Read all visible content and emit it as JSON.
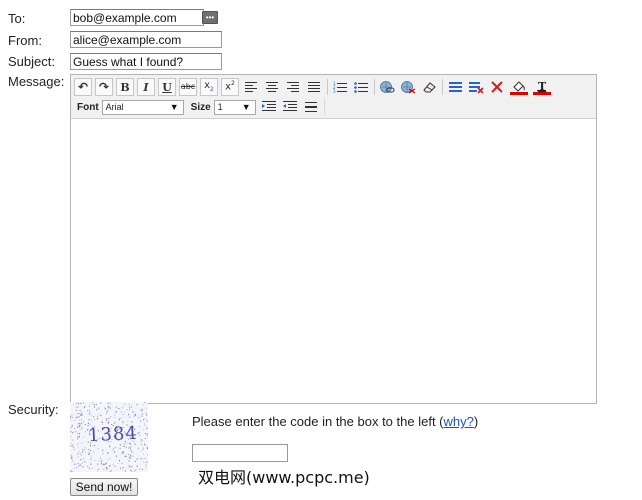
{
  "form": {
    "to_label": "To:",
    "to_value": "bob@example.com",
    "from_label": "From:",
    "from_value": "alice@example.com",
    "subject_label": "Subject:",
    "subject_value": "Guess what I found?",
    "message_label": "Message:",
    "security_label": "Security:"
  },
  "toolbar": {
    "row1": [
      {
        "name": "undo-button",
        "glyph": "↶",
        "title": "undo"
      },
      {
        "name": "redo-button",
        "glyph": "↷",
        "title": "redo"
      },
      {
        "name": "bold-button",
        "glyph": "B",
        "title": "bold"
      },
      {
        "name": "italic-button",
        "glyph": "I",
        "title": "italic"
      },
      {
        "name": "underline-button",
        "glyph": "U",
        "title": "underline"
      },
      {
        "name": "strikethrough-button",
        "glyph": "abc",
        "title": "strikethrough"
      },
      {
        "name": "subscript-button",
        "glyph": "x₂",
        "title": "subscript"
      },
      {
        "name": "superscript-button",
        "glyph": "x²",
        "title": "superscript"
      }
    ],
    "font_label": "Font",
    "font_value": "Arial",
    "size_label": "Size",
    "size_value": "1",
    "icons": {
      "align_left": "align-left-icon",
      "align_center": "align-center-icon",
      "align_right": "align-right-icon",
      "justify": "align-justify-icon",
      "ordered_list": "ordered-list-icon",
      "unordered_list": "unordered-list-icon",
      "link": "link-icon",
      "unlink": "unlink-icon",
      "eraser": "eraser-icon",
      "blue_block": "blue-paragraph-icon",
      "clear_format": "clear-format-icon",
      "close": "close-red-icon",
      "fill_color": "fill-color-icon",
      "text_color": "text-color-icon",
      "indent": "indent-icon",
      "outdent": "outdent-icon",
      "horizontal_rule": "horizontal-rule-icon"
    },
    "colors": {
      "red_bar": "#e00000",
      "blue": "#2a62c9",
      "close_red": "#d81b1b"
    }
  },
  "security": {
    "captcha_code": "1384",
    "prompt_text": "Please enter the code in the box to the left (",
    "prompt_link": "why?",
    "prompt_close": ")",
    "code_value": "",
    "send_label": "Send now!"
  },
  "watermark": "双电网(www.pcpc.me)"
}
